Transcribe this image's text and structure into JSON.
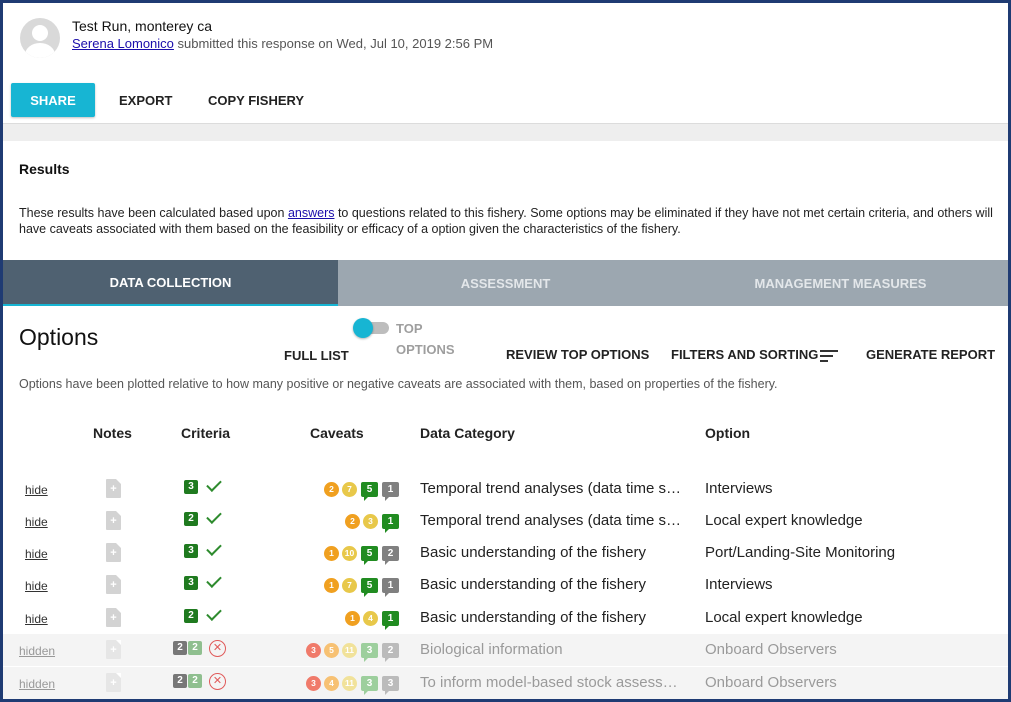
{
  "header": {
    "title": "Test Run, monterey ca",
    "author": "Serena Lomonico",
    "submitted_text": " submitted this response on Wed, Jul 10, 2019 2:56 PM"
  },
  "actions": {
    "share": "SHARE",
    "export": "EXPORT",
    "copy": "COPY FISHERY"
  },
  "results": {
    "title": "Results",
    "text_before": "These results have been calculated based upon ",
    "link": "answers",
    "text_after": " to questions related to this fishery. Some options may be eliminated if they have not met certain criteria, and others will have caveats associated with them based on the feasibility or efficacy of a option given the characteristics of the fishery."
  },
  "tabs": [
    {
      "label": "DATA COLLECTION",
      "active": true
    },
    {
      "label": "ASSESSMENT",
      "active": false
    },
    {
      "label": "MANAGEMENT MEASURES",
      "active": false
    }
  ],
  "options": {
    "title": "Options",
    "full_list": "FULL LIST",
    "top_options": "TOP OPTIONS",
    "review": "REVIEW TOP OPTIONS",
    "filters": "FILTERS AND SORTING",
    "generate": "GENERATE REPORT",
    "description": "Options have been plotted relative to how many positive or negative caveats are associated with them, based on properties of the fishery."
  },
  "columns": {
    "notes": "Notes",
    "criteria": "Criteria",
    "caveats": "Caveats",
    "category": "Data Category",
    "option": "Option"
  },
  "rows": [
    {
      "link": "hide",
      "crit": "3",
      "dots": [
        "2",
        "7"
      ],
      "pos": "5",
      "neg": "1",
      "category": "Temporal trend analyses (data time s…",
      "option": "Interviews"
    },
    {
      "link": "hide",
      "crit": "2",
      "dots": [
        "2",
        "3"
      ],
      "pos": "1",
      "neg": "",
      "category": "Temporal trend analyses (data time s…",
      "option": "Local expert knowledge"
    },
    {
      "link": "hide",
      "crit": "3",
      "dots": [
        "1",
        "10"
      ],
      "pos": "5",
      "neg": "2",
      "category": "Basic understanding of the fishery",
      "option": "Port/Landing-Site Monitoring"
    },
    {
      "link": "hide",
      "crit": "3",
      "dots": [
        "1",
        "7"
      ],
      "pos": "5",
      "neg": "1",
      "category": "Basic understanding of the fishery",
      "option": "Interviews"
    },
    {
      "link": "hide",
      "crit": "2",
      "dots": [
        "1",
        "4"
      ],
      "pos": "1",
      "neg": "",
      "category": "Basic understanding of the fishery",
      "option": "Local expert knowledge"
    },
    {
      "link": "hidden",
      "crit_a": "2",
      "crit_b": "2",
      "dots": [
        "3",
        "5",
        "11"
      ],
      "pos": "3",
      "neg": "2",
      "category": "Biological information",
      "option": "Onboard Observers"
    },
    {
      "link": "hidden",
      "crit_a": "2",
      "crit_b": "2",
      "dots": [
        "3",
        "4",
        "11"
      ],
      "pos": "3",
      "neg": "3",
      "category": "To inform model-based stock assess…",
      "option": "Onboard Observers"
    }
  ]
}
